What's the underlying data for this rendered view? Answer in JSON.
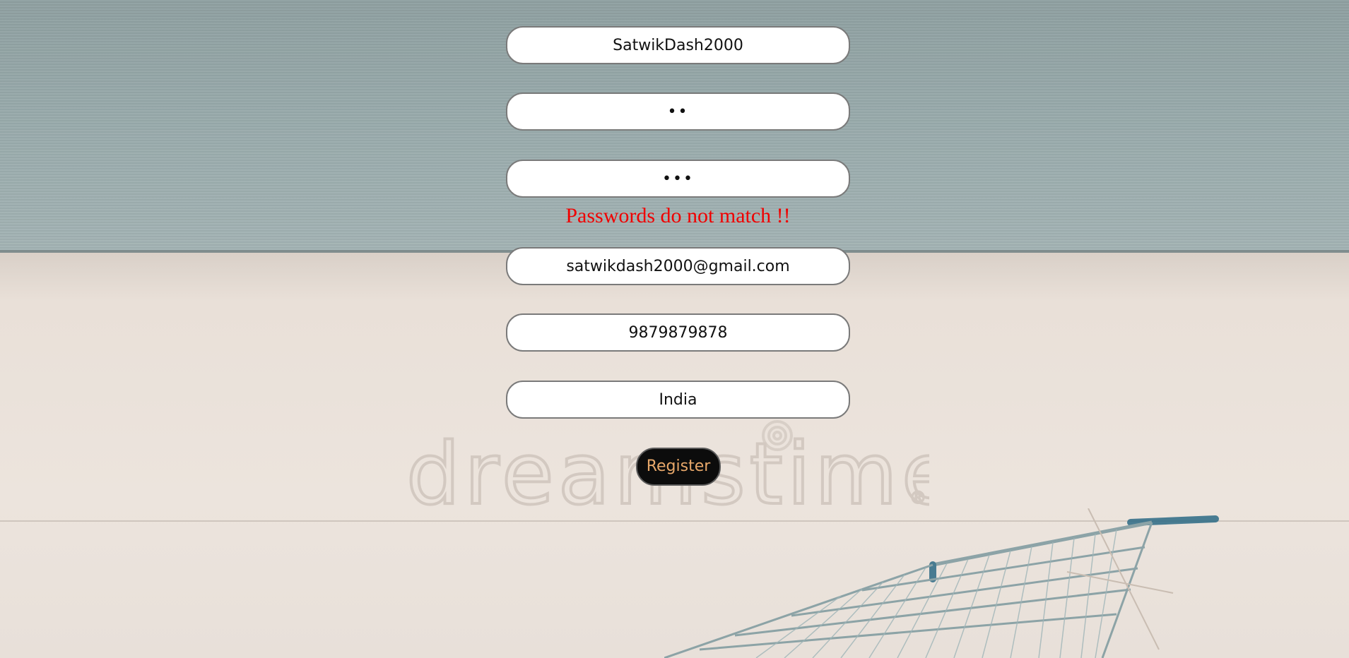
{
  "form": {
    "username_value": "SatwikDash2000",
    "password_value": "••",
    "confirm_password_value": "•••",
    "error_message": "Passwords do not match !!",
    "email_value": "satwikdash2000@gmail.com",
    "phone_value": "9879879878",
    "country_value": "India",
    "register_label": "Register"
  },
  "background": {
    "watermark_text": "dreamstime",
    "watermark_icon": "spiral-logo-icon",
    "illustration": "shopping-cart-icon"
  },
  "colors": {
    "error": "#f00000",
    "button_bg": "#0c0c0c",
    "button_text": "#e8a86a",
    "wall": "#98aaab",
    "floor": "#ece4dd"
  }
}
